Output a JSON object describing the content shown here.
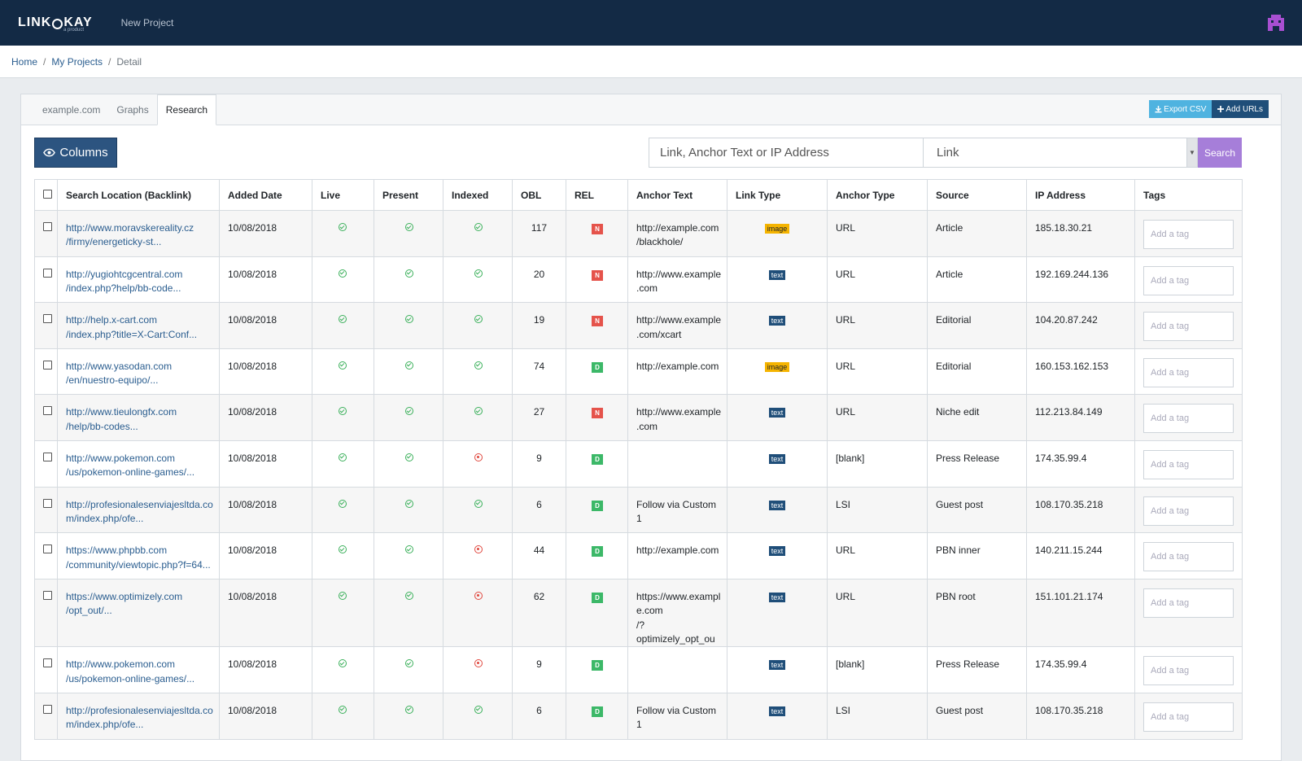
{
  "header": {
    "logo_left": "LINK",
    "logo_right": "KAY",
    "logo_sub": "a product",
    "project_name": "New Project"
  },
  "breadcrumb": {
    "home": "Home",
    "projects": "My Projects",
    "current": "Detail"
  },
  "tabs": [
    {
      "label": "example.com",
      "active": false
    },
    {
      "label": "Graphs",
      "active": false
    },
    {
      "label": "Research",
      "active": true
    }
  ],
  "actions": {
    "export_csv": "Export CSV",
    "add_urls": "Add URLs"
  },
  "toolbar": {
    "columns_label": "Columns",
    "search_placeholder": "Link, Anchor Text or IP Address",
    "search_field_selected": "Link",
    "search_button": "Search"
  },
  "table": {
    "headers": [
      "Search Location (Backlink)",
      "Added Date",
      "Live",
      "Present",
      "Indexed",
      "OBL",
      "REL",
      "Anchor Text",
      "Link Type",
      "Anchor Type",
      "Source",
      "IP Address",
      "Tags"
    ],
    "tag_placeholder": "Add a tag",
    "rows": [
      {
        "url1": "http://www.moravskereality.cz",
        "url2": "/firmy/energeticky-st...",
        "date": "10/08/2018",
        "live": true,
        "present": true,
        "indexed": true,
        "obl": "117",
        "rel": "N",
        "anchor": [
          "http://example.com",
          "/blackhole/"
        ],
        "link_type": "image",
        "anchor_type": "URL",
        "source": "Article",
        "ip": "185.18.30.21"
      },
      {
        "url1": "http://yugiohtcgcentral.com",
        "url2": "/index.php?help/bb-code...",
        "date": "10/08/2018",
        "live": true,
        "present": true,
        "indexed": true,
        "obl": "20",
        "rel": "N",
        "anchor": [
          "http://www.example",
          ".com"
        ],
        "link_type": "text",
        "anchor_type": "URL",
        "source": "Article",
        "ip": "192.169.244.136"
      },
      {
        "url1": "http://help.x-cart.com",
        "url2": "/index.php?title=X-Cart:Conf...",
        "date": "10/08/2018",
        "live": true,
        "present": true,
        "indexed": true,
        "obl": "19",
        "rel": "N",
        "anchor": [
          "http://www.example",
          ".com/xcart"
        ],
        "link_type": "text",
        "anchor_type": "URL",
        "source": "Editorial",
        "ip": "104.20.87.242"
      },
      {
        "url1": "http://www.yasodan.com",
        "url2": "/en/nuestro-equipo/...",
        "date": "10/08/2018",
        "live": true,
        "present": true,
        "indexed": true,
        "obl": "74",
        "rel": "D",
        "anchor": [
          "http://example.com"
        ],
        "link_type": "image",
        "anchor_type": "URL",
        "source": "Editorial",
        "ip": "160.153.162.153"
      },
      {
        "url1": "http://www.tieulongfx.com",
        "url2": "/help/bb-codes...",
        "date": "10/08/2018",
        "live": true,
        "present": true,
        "indexed": true,
        "obl": "27",
        "rel": "N",
        "anchor": [
          "http://www.example",
          ".com"
        ],
        "link_type": "text",
        "anchor_type": "URL",
        "source": "Niche edit",
        "ip": "112.213.84.149"
      },
      {
        "url1": "http://www.pokemon.com",
        "url2": "/us/pokemon-online-games/...",
        "date": "10/08/2018",
        "live": true,
        "present": true,
        "indexed": false,
        "obl": "9",
        "rel": "D",
        "anchor": [],
        "link_type": "text",
        "anchor_type": "[blank]",
        "source": "Press Release",
        "ip": "174.35.99.4"
      },
      {
        "url1": "http://profesionalesenviajesltda.co",
        "url2": "m/index.php/ofe...",
        "date": "10/08/2018",
        "live": true,
        "present": true,
        "indexed": true,
        "obl": "6",
        "rel": "D",
        "anchor": [
          "Follow via Custom 1"
        ],
        "link_type": "text",
        "anchor_type": "LSI",
        "source": "Guest post",
        "ip": "108.170.35.218"
      },
      {
        "url1": "https://www.phpbb.com",
        "url2": "/community/viewtopic.php?f=64...",
        "date": "10/08/2018",
        "live": true,
        "present": true,
        "indexed": false,
        "obl": "44",
        "rel": "D",
        "anchor": [
          "http://example.com"
        ],
        "link_type": "text",
        "anchor_type": "URL",
        "source": "PBN inner",
        "ip": "140.211.15.244"
      },
      {
        "url1": "https://www.optimizely.com",
        "url2": "/opt_out/...",
        "date": "10/08/2018",
        "live": true,
        "present": true,
        "indexed": false,
        "obl": "62",
        "rel": "D",
        "anchor": [
          "https://www.exampl",
          "e.com",
          "/?optimizely_opt_ou"
        ],
        "link_type": "text",
        "anchor_type": "URL",
        "source": "PBN root",
        "ip": "151.101.21.174"
      },
      {
        "url1": "http://www.pokemon.com",
        "url2": "/us/pokemon-online-games/...",
        "date": "10/08/2018",
        "live": true,
        "present": true,
        "indexed": false,
        "obl": "9",
        "rel": "D",
        "anchor": [],
        "link_type": "text",
        "anchor_type": "[blank]",
        "source": "Press Release",
        "ip": "174.35.99.4"
      },
      {
        "url1": "http://profesionalesenviajesltda.co",
        "url2": "m/index.php/ofe...",
        "date": "10/08/2018",
        "live": true,
        "present": true,
        "indexed": true,
        "obl": "6",
        "rel": "D",
        "anchor": [
          "Follow via Custom 1"
        ],
        "link_type": "text",
        "anchor_type": "LSI",
        "source": "Guest post",
        "ip": "108.170.35.218"
      }
    ]
  }
}
